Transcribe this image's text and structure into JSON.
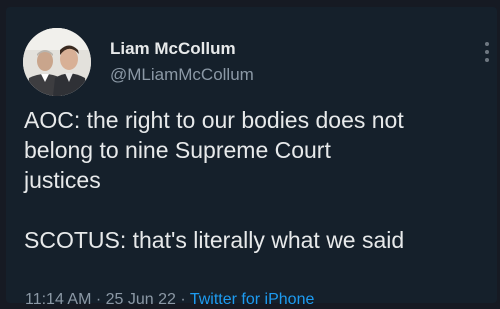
{
  "tweet": {
    "author": {
      "display_name": "Liam McCollum",
      "handle": "@MLiamMcCollum",
      "avatar_icon": "profile-photo-two-men"
    },
    "body": {
      "line1": "AOC: the right to our bodies does not",
      "line2": "belong to nine Supreme Court",
      "line3": "justices",
      "line4": "SCOTUS: that's literally what we said"
    },
    "meta": {
      "time": "11:14 AM",
      "separator1": " · ",
      "date": "25 Jun 22",
      "separator2": " · ",
      "source": "Twitter for iPhone"
    },
    "more_icon": "vertical-ellipsis-icon"
  },
  "colors": {
    "background": "#15202b",
    "text": "#e7e9ea",
    "secondary_text": "#8b98a5",
    "link": "#1d9bf0"
  }
}
